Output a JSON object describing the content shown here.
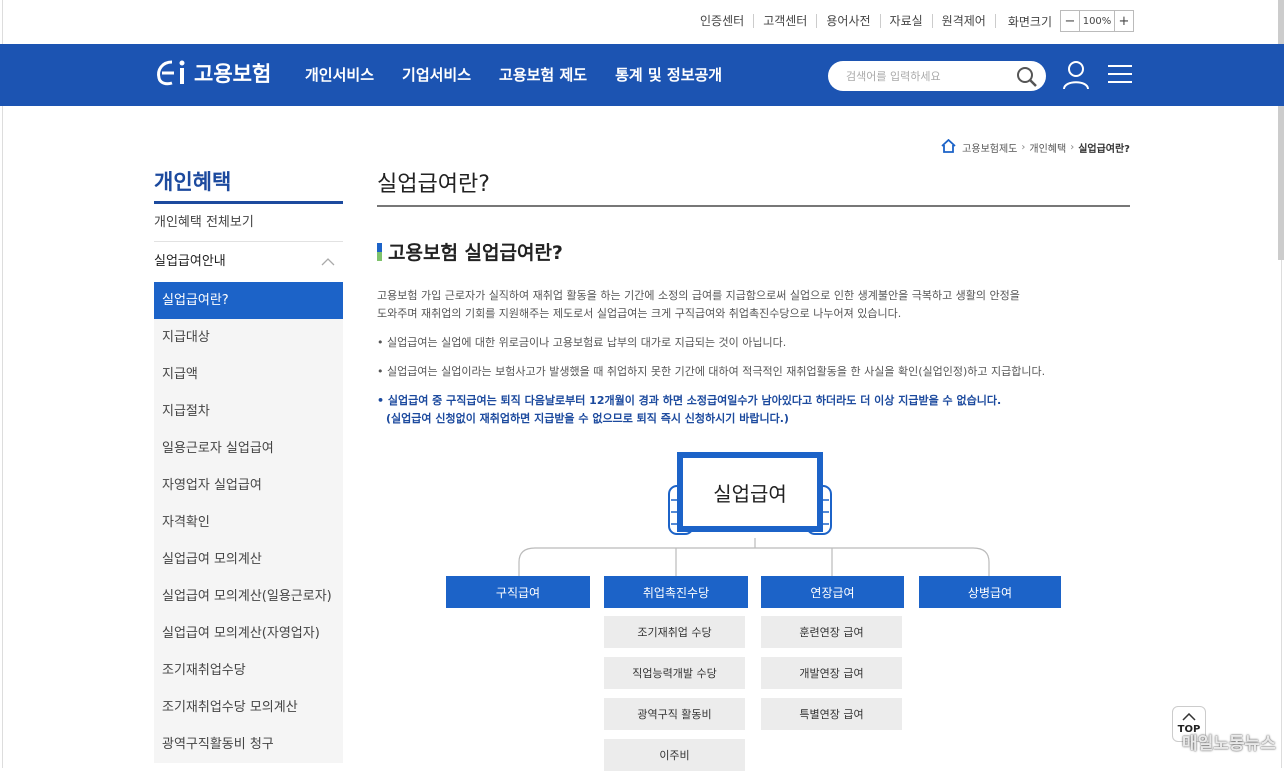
{
  "util": {
    "links": [
      "인증센터",
      "고객센터",
      "용어사전",
      "자료실",
      "원격제어"
    ],
    "zoom_label": "화면크기",
    "zoom_minus": "−",
    "zoom_value": "100%",
    "zoom_plus": "+"
  },
  "header": {
    "logo_text": "고용보험",
    "menu": [
      "개인서비스",
      "기업서비스",
      "고용보험 제도",
      "통계 및 정보공개"
    ],
    "search_placeholder": "검색어를 입력하세요"
  },
  "breadcrumb": [
    "고용보험제도",
    "개인혜택",
    "실업급여란?"
  ],
  "lnb": {
    "title": "개인혜택",
    "all_link": "개인혜택 전체보기",
    "group": "실업급여안내",
    "items": [
      "실업급여란?",
      "지급대상",
      "지급액",
      "지급절차",
      "일용근로자 실업급여",
      "자영업자 실업급여",
      "자격확인",
      "실업급여 모의계산",
      "실업급여 모의계산(일용근로자)",
      "실업급여 모의계산(자영업자)",
      "조기재취업수당",
      "조기재취업수당 모의계산",
      "광역구직활동비 청구"
    ]
  },
  "content": {
    "page_title": "실업급여란?",
    "section_title": "고용보험 실업급여란?",
    "intro_line1": "고용보험 가입 근로자가 실직하여 재취업 활동을 하는 기간에 소정의 급여를 지급함으로써 실업으로 인한 생계불안을 극복하고 생활의 안정을",
    "intro_line2": "도와주며 재취업의 기회를 지원해주는 제도로서 실업급여는 크게 구직급여와 취업촉진수당으로 나누어져 있습니다.",
    "bullet1": "• 실업급여는 실업에 대한 위로금이나 고용보험료 납부의 대가로 지급되는 것이 아닙니다.",
    "bullet2": "• 실업급여는 실업이라는 보험사고가 발생했을 때 취업하지 못한 기간에 대하여 적극적인 재취업활동을 한 사실을 확인(실업인정)하고 지급합니다.",
    "bullet3_line1": "• 실업급여 중 구직급여는 퇴직 다음날로부터 12개월이 경과 하면 소정급여일수가 남아있다고 하더라도 더 이상 지급받을 수 없습니다.",
    "bullet3_line2": "(실업급여 신청없이 재취업하면 지급받을 수 없으므로 퇴직 즉시 신청하시기 바랍니다.)"
  },
  "diagram": {
    "root": "실업급여",
    "categories": [
      "구직급여",
      "취업촉진수당",
      "연장급여",
      "상병급여"
    ],
    "promotion_items": [
      "조기재취업 수당",
      "직업능력개발 수당",
      "광역구직 활동비",
      "이주비"
    ],
    "extension_items": [
      "훈련연장 급여",
      "개발연장 급여",
      "특별연장 급여"
    ]
  },
  "top_button": "TOP",
  "watermark": "매일노동뉴스",
  "colors": {
    "brand_blue": "#1c54b2",
    "accent_blue": "#1c63c8",
    "sub_gray": "#ececec"
  }
}
